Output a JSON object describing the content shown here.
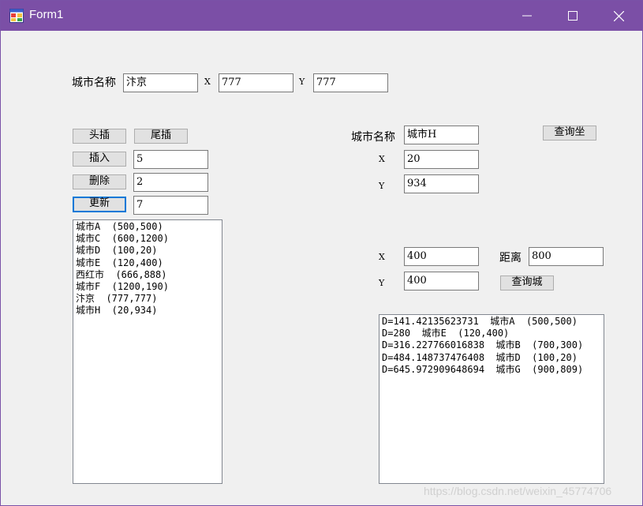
{
  "window": {
    "title": "Form1",
    "minimize_glyph": "—",
    "maximize_glyph": "☐",
    "close_glyph": "✕"
  },
  "top_row": {
    "city_name_label": "城市名称",
    "city_name_value": "汴京",
    "x_label": "X",
    "x_value": "777",
    "y_label": "Y",
    "y_value": "777"
  },
  "left_panel": {
    "head_insert_label": "头插",
    "tail_insert_label": "尾插",
    "insert_label": "插入",
    "insert_value": "5",
    "delete_label": "删除",
    "delete_value": "2",
    "update_label": "更新",
    "update_value": "7",
    "city_list": [
      "城市A  (500,500)",
      "城市C  (600,1200)",
      "城市D  (100,20)",
      "城市E  (120,400)",
      "西红市  (666,888)",
      "城市F  (1200,190)",
      "汴京  (777,777)",
      "城市H  (20,934)"
    ]
  },
  "query_coords": {
    "city_name_label": "城市名称",
    "city_name_value": "城市H",
    "button_label": "查询坐",
    "x_label": "X",
    "x_value": "20",
    "y_label": "Y",
    "y_value": "934"
  },
  "query_cities": {
    "x_label": "X",
    "x_value": "400",
    "y_label": "Y",
    "y_value": "400",
    "distance_label": "距离",
    "distance_value": "800",
    "button_label": "查询城",
    "results": [
      "D=141.42135623731  城市A  (500,500)",
      "D=280  城市E  (120,400)",
      "D=316.227766016838  城市B  (700,300)",
      "D=484.148737476408  城市D  (100,20)",
      "D=645.972909648694  城市G  (900,809)"
    ]
  },
  "watermark": "https://blog.csdn.net/weixin_45774706",
  "colors": {
    "titlebar": "#7b4fa6",
    "window_bg": "#f0f0f0",
    "focus_border": "#0078d7"
  },
  "icons": {
    "app": "form-app-icon"
  }
}
